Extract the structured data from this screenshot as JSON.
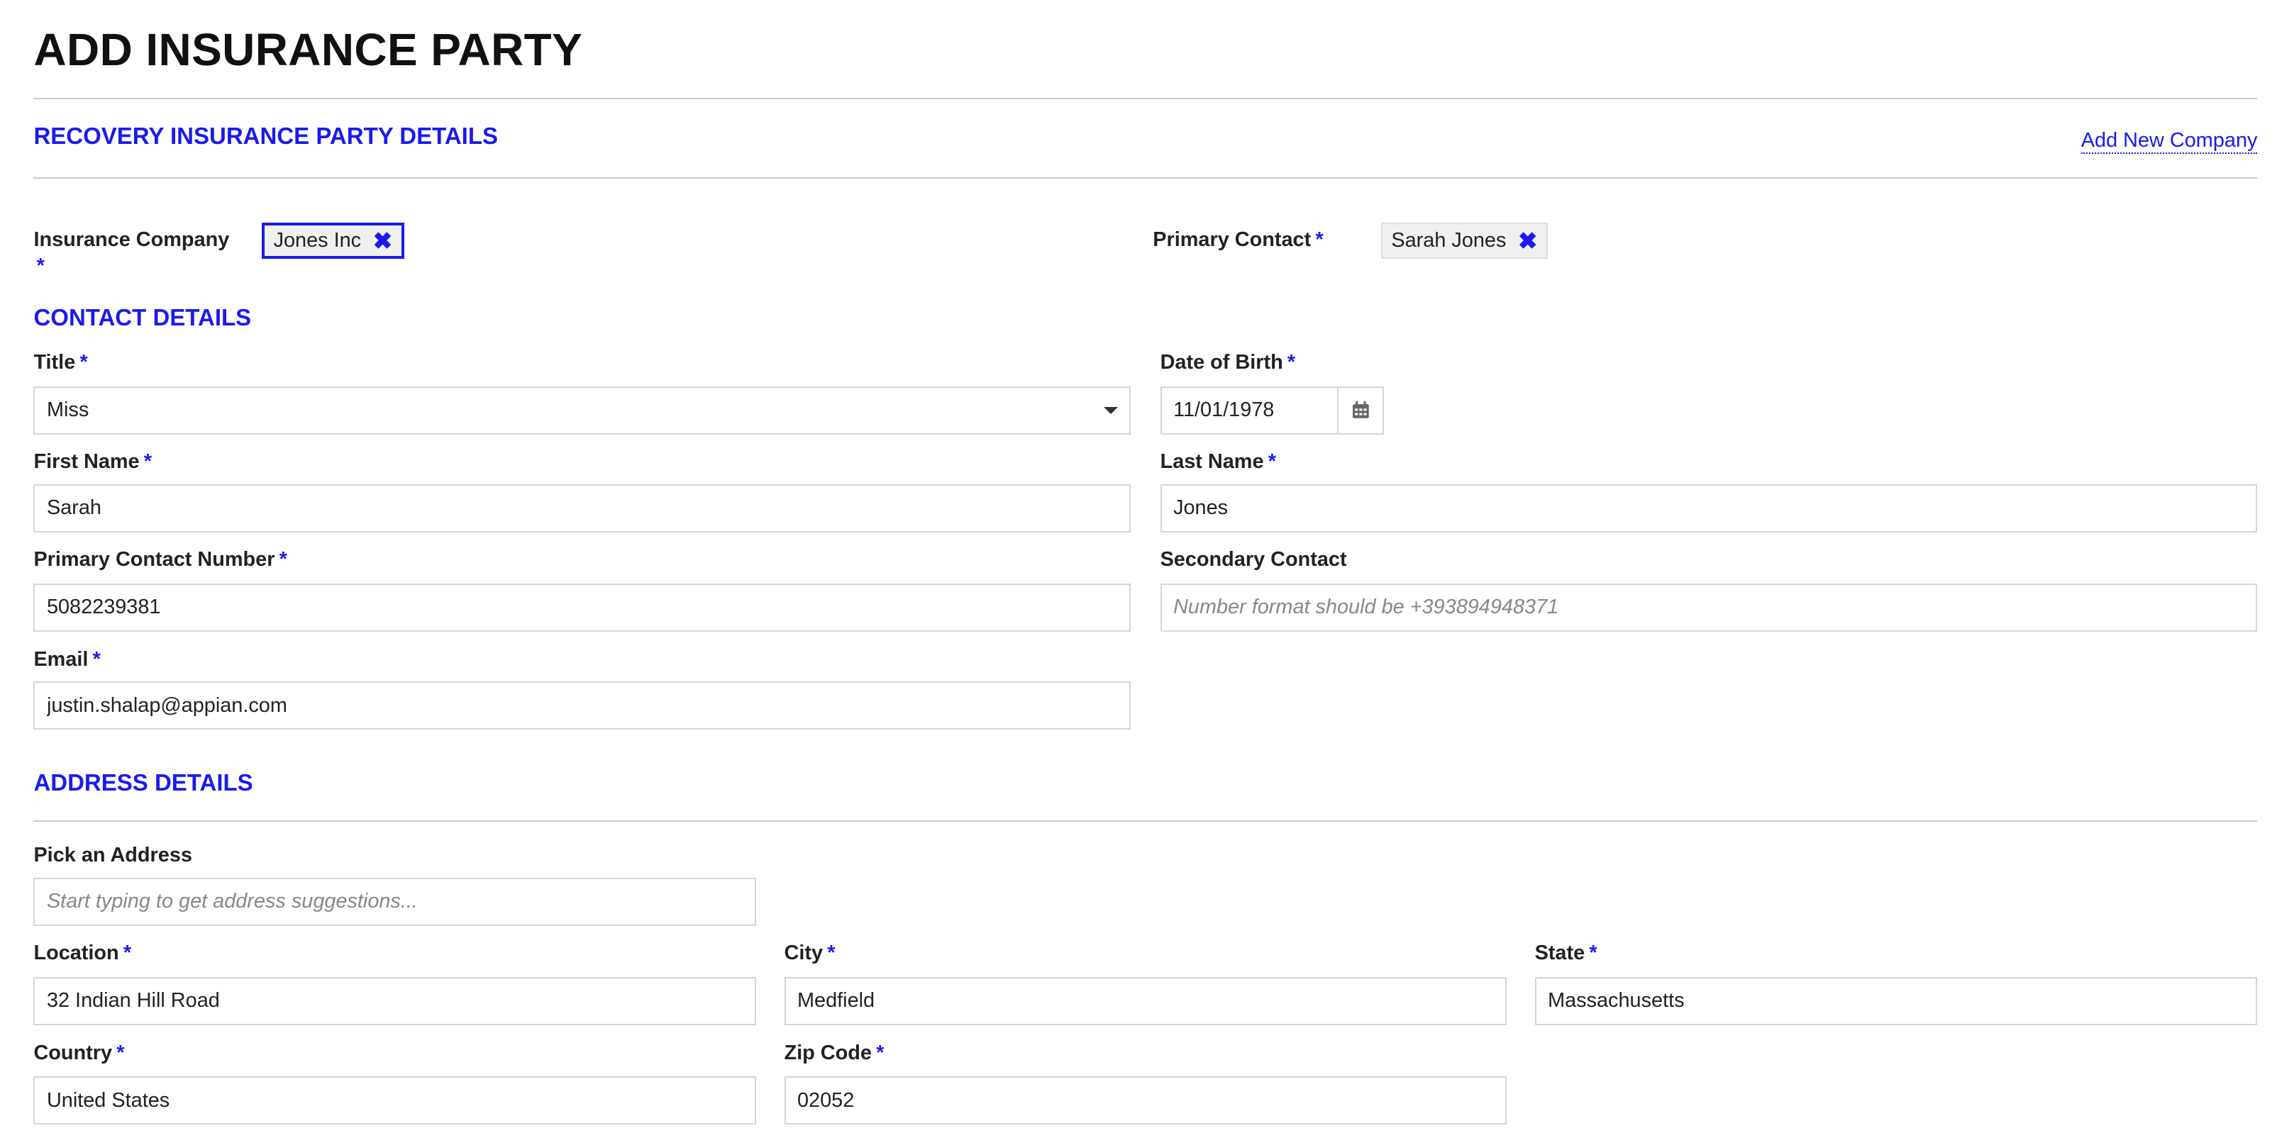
{
  "title": "ADD INSURANCE PARTY",
  "recovery": {
    "heading": "RECOVERY INSURANCE PARTY DETAILS",
    "add_company_link": "Add New Company",
    "insurance_company": {
      "label": "Insurance Company",
      "value": "Jones Inc"
    },
    "primary_contact": {
      "label": "Primary Contact",
      "value": "Sarah Jones"
    }
  },
  "required_marker": "*",
  "contact": {
    "heading": "CONTACT DETAILS",
    "title": {
      "label": "Title",
      "value": "Miss"
    },
    "dob": {
      "label": "Date of Birth",
      "value": "11/01/1978"
    },
    "first_name": {
      "label": "First Name",
      "value": "Sarah"
    },
    "last_name": {
      "label": "Last Name",
      "value": "Jones"
    },
    "primary_number": {
      "label": "Primary Contact Number",
      "value": "5082239381"
    },
    "secondary": {
      "label": "Secondary Contact",
      "placeholder": "Number format should be +393894948371"
    },
    "email": {
      "label": "Email",
      "value": "justin.shalap@appian.com"
    }
  },
  "address": {
    "heading": "ADDRESS DETAILS",
    "pick": {
      "label": "Pick an Address",
      "placeholder": "Start typing to get address suggestions..."
    },
    "location": {
      "label": "Location",
      "value": "32 Indian Hill Road"
    },
    "city": {
      "label": "City",
      "value": "Medfield"
    },
    "state": {
      "label": "State",
      "value": "Massachusetts"
    },
    "country": {
      "label": "Country",
      "value": "United States"
    },
    "zip": {
      "label": "Zip Code",
      "value": "02052"
    }
  },
  "colors": {
    "accent": "#1a1aee"
  }
}
